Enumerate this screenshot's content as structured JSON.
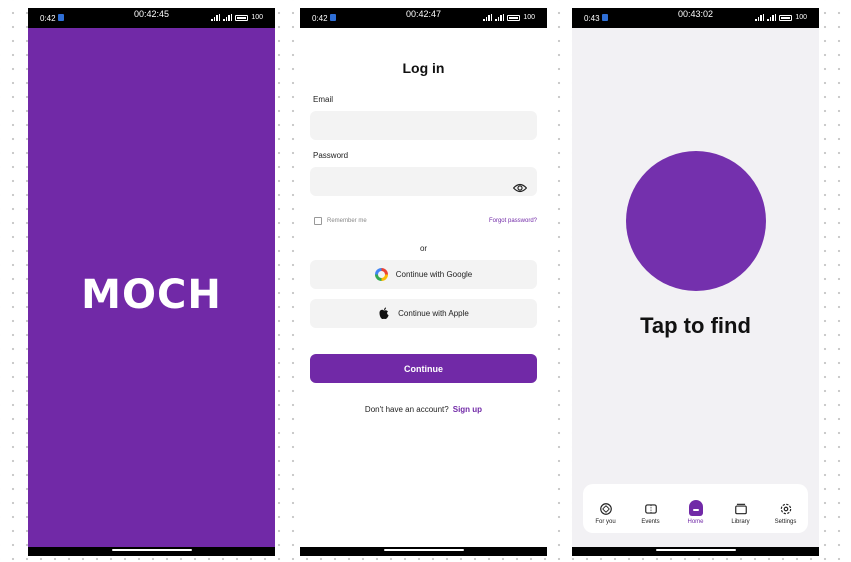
{
  "colors": {
    "brand": "#7129a7",
    "field_bg": "#f3f3f3",
    "home_bg": "#f2f1f4"
  },
  "screens": {
    "splash": {
      "status": {
        "time": "0:42",
        "clock": "00:42:45",
        "battery": "100"
      },
      "logo": "MOCH"
    },
    "login": {
      "status": {
        "time": "0:42",
        "clock": "00:42:47",
        "battery": "100"
      },
      "title": "Log in",
      "email_label": "Email",
      "email_value": "",
      "password_label": "Password",
      "password_value": "",
      "remember": "Remember me",
      "forgot": "Forgot password?",
      "or": "or",
      "google": "Continue with Google",
      "apple": "Continue with Apple",
      "continue": "Continue",
      "no_account": "Don't have an account?",
      "signup": "Sign up"
    },
    "home": {
      "status": {
        "time": "0:43",
        "clock": "00:43:02",
        "battery": "100"
      },
      "tap": "Tap to find",
      "tabs": [
        {
          "label": "For you",
          "icon": "dice-icon"
        },
        {
          "label": "Events",
          "icon": "ticket-icon"
        },
        {
          "label": "Home",
          "icon": "home-icon",
          "active": true
        },
        {
          "label": "Library",
          "icon": "library-icon"
        },
        {
          "label": "Settings",
          "icon": "gear-icon"
        }
      ]
    }
  }
}
